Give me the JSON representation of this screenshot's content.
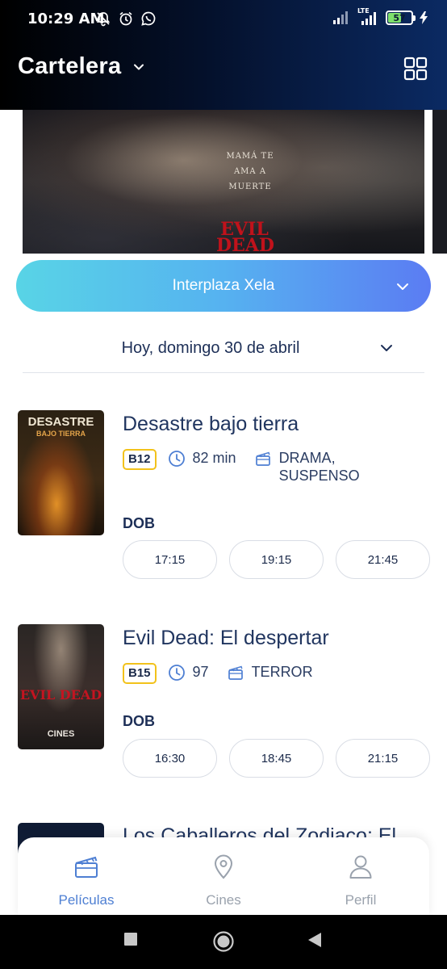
{
  "status_bar": {
    "time": "10:29 AM",
    "network": "LTE",
    "battery": "57",
    "battery_level": 0.57
  },
  "header": {
    "title": "Cartelera",
    "title_dropdown_icon": "chevron-down-icon",
    "view_toggle_icon": "grid-view-icon"
  },
  "hero": {
    "tagline": "MAMÁ TE AMA A MUERTE",
    "logo": "EVIL DEAD"
  },
  "cinema_selector": {
    "value": "Interplaza Xela"
  },
  "date_selector": {
    "value": "Hoy, domingo 30 de abril"
  },
  "movies": [
    {
      "title": "Desastre bajo tierra",
      "poster_title": "DESASTRE",
      "poster_subtitle": "BAJO TIERRA",
      "rating": "B12",
      "duration": "82 min",
      "genre_line1": "DRAMA,",
      "genre_line2": "SUSPENSO",
      "language": "DOB",
      "showtimes": [
        "17:15",
        "19:15",
        "21:45"
      ]
    },
    {
      "title": "Evil Dead: El despertar",
      "poster_logo": "EVIL DEAD",
      "poster_footer": "CINES",
      "rating": "B15",
      "duration": "97",
      "genre_line1": "TERROR",
      "language": "DOB",
      "showtimes": [
        "16:30",
        "18:45",
        "21:15"
      ]
    },
    {
      "title": "Los Caballeros del Zodiaco: El"
    }
  ],
  "bottom_nav": {
    "items": [
      {
        "label": "Películas",
        "icon": "clapperboard-icon",
        "active": true
      },
      {
        "label": "Cines",
        "icon": "map-pin-icon",
        "active": false
      },
      {
        "label": "Perfil",
        "icon": "user-icon",
        "active": false
      }
    ]
  },
  "colors": {
    "header_dark": "#04102a",
    "header_navy": "#0b2a63",
    "accent_blue": "#4e7fd3",
    "title_navy": "#20355f",
    "rating_border": "#f2c21b",
    "selector_start": "#58d4e6",
    "selector_end": "#5b7cf3"
  }
}
